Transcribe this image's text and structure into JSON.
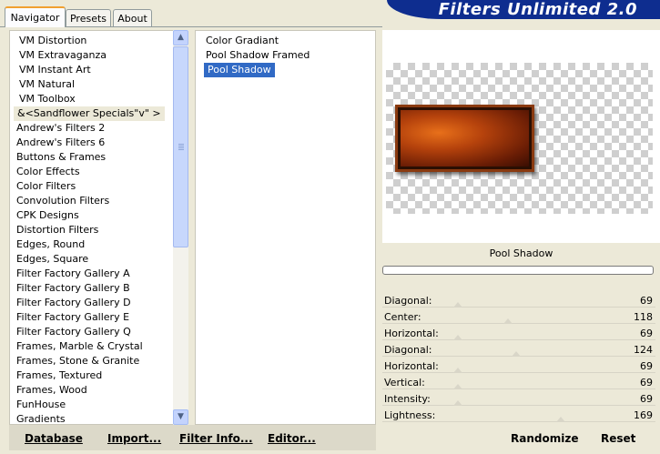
{
  "tabs": [
    {
      "label": "Navigator",
      "active": true
    },
    {
      "label": "Presets",
      "active": false
    },
    {
      "label": "About",
      "active": false
    }
  ],
  "brand": "Filters Unlimited 2.0",
  "categories": [
    "VM Distortion",
    "VM Extravaganza",
    "VM Instant Art",
    "VM Natural",
    "VM Toolbox",
    "&<Sandflower Specials\"v\" >",
    "Andrew's Filters 2",
    "Andrew's Filters 6",
    "Buttons & Frames",
    "Color Effects",
    "Color Filters",
    "Convolution Filters",
    "CPK Designs",
    "Distortion Filters",
    "Edges, Round",
    "Edges, Square",
    "Filter Factory Gallery A",
    "Filter Factory Gallery B",
    "Filter Factory Gallery D",
    "Filter Factory Gallery E",
    "Filter Factory Gallery Q",
    "Frames, Marble & Crystal",
    "Frames, Stone & Granite",
    "Frames, Textured",
    "Frames, Wood",
    "FunHouse",
    "Gradients"
  ],
  "selected_category_index": 5,
  "filters": [
    "Color Gradiant",
    "Pool Shadow Framed",
    "Pool Shadow"
  ],
  "selected_filter_index": 2,
  "preview_name": "Pool Shadow",
  "params": [
    {
      "label": "Diagonal:",
      "value": "69",
      "level": 0.27
    },
    {
      "label": "Center:",
      "value": "118",
      "level": 0.46
    },
    {
      "label": "Horizontal:",
      "value": "69",
      "level": 0.27
    },
    {
      "label": "Diagonal:",
      "value": "124",
      "level": 0.49
    },
    {
      "label": "Horizontal:",
      "value": "69",
      "level": 0.27
    },
    {
      "label": "Vertical:",
      "value": "69",
      "level": 0.27
    },
    {
      "label": "Intensity:",
      "value": "69",
      "level": 0.27
    },
    {
      "label": "Lightness:",
      "value": "169",
      "level": 0.66
    }
  ],
  "buttons": {
    "database": "Database",
    "import": "Import...",
    "filter_info": "Filter Info...",
    "editor": "Editor...",
    "randomize": "Randomize",
    "reset": "Reset"
  },
  "colors": {
    "brand_bg": "#0e2d8f",
    "selection": "#316ac5",
    "tab_accent": "#f0a030"
  }
}
